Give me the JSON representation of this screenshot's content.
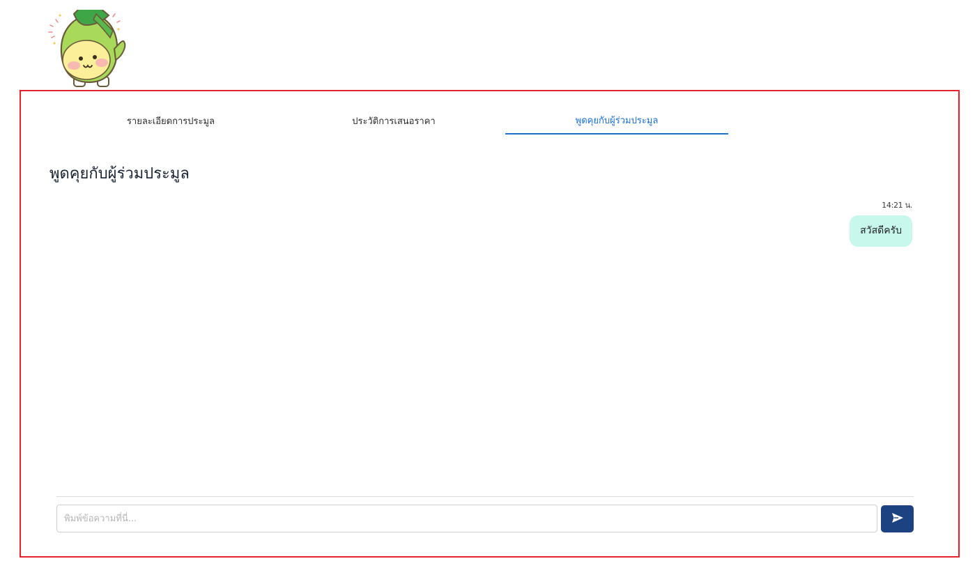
{
  "tabs": [
    {
      "label": "รายละเอียดการประมูล",
      "active": false
    },
    {
      "label": "ประวัติการเสนอราคา",
      "active": false
    },
    {
      "label": "พูดคุยกับผู้ร่วมประมูล",
      "active": true
    }
  ],
  "chat": {
    "title": "พูดคุยกับผู้ร่วมประมูล",
    "messages": [
      {
        "time": "14:21 น.",
        "text": "สวัสดีครับ"
      }
    ]
  },
  "composer": {
    "placeholder": "พิมพ์ข้อความที่นี่...",
    "value": "",
    "send_icon": "send-icon"
  },
  "colors": {
    "accent": "#1b6fd1",
    "send_button": "#1c4282",
    "bubble": "#c8f7ec",
    "panel_border": "#e5212b"
  }
}
